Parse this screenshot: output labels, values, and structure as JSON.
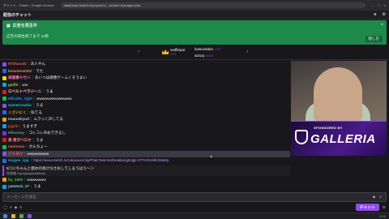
{
  "browser": {
    "title": "チャット - Twitch - Google Chrome",
    "url": "dashboard.twitch.tv/popout/u/.../stream-manager/chat",
    "controls": [
      "–",
      "□",
      "×"
    ]
  },
  "header": {
    "title": "配信のチャット",
    "icons": [
      "users-icon",
      "gear-icon"
    ]
  },
  "ad": {
    "title": "広告を再生中",
    "subtitle": "広告の再生終了まで 14秒",
    "button": "隠しを"
  },
  "leaderboard": {
    "first": {
      "name": "wafflepar",
      "bits": "173"
    },
    "second": {
      "name": "katsuokako",
      "bits": "172"
    },
    "third": {
      "name": "aizuoj",
      "bits": "6975"
    },
    "count1": "173"
  },
  "messages": [
    {
      "user": "87Shasaki",
      "user_color": "#ff4f4f",
      "badge": "#9147ff",
      "text": "あ人やん"
    },
    {
      "user": "kinanmo0202",
      "user_color": "#ff7f50",
      "badge": "#1f69ff",
      "text": "でた"
    },
    {
      "user": "高額重々せい",
      "user_color": "#ff69b4",
      "badge": "#ffd700",
      "text": "あいつは頭悪ゲームくそうまい"
    },
    {
      "user": "gaifiti",
      "user_color": "#9acd32",
      "badge": "#00a8e8",
      "text": "ww"
    },
    {
      "user": "ロベルトベラジーニ",
      "user_color": "#ffb3ba",
      "badge": "#e91916",
      "text": "うま"
    },
    {
      "user": "ellisabo_right",
      "user_color": "#1e90ff",
      "badge": "#00c853",
      "text": "wwwwwwwwwwwww"
    },
    {
      "user": "numeronakiu",
      "user_color": "#00ced1",
      "badge": "#9147ff",
      "text": "うま"
    },
    {
      "user": "くさいにく",
      "user_color": "#daa520",
      "badge": "#1f69ff",
      "text": "似てる"
    },
    {
      "user": "muouskyurt",
      "user_color": "#b0c4de",
      "badge": "#ff9f00",
      "text": "ムラっく声してる"
    },
    {
      "user": "jagir0",
      "user_color": "#ff4500",
      "badge": "#00a8e8",
      "text": "うますぎ"
    },
    {
      "user": "ellisonoy",
      "user_color": "#5f9ea0",
      "badge": "#8a2be2",
      "text": "コレコレ声おできるし"
    },
    {
      "user": "高 黒沢ベロキ",
      "user_color": "#ff7f7f",
      "badge": "#e91916",
      "text": "うま"
    },
    {
      "user": "nanionsu",
      "user_color": "#ff6347",
      "badge": "#00c853",
      "text": "かんちょー"
    },
    {
      "user": "ひろあけ",
      "user_color": "#ff4f4f",
      "badge": "#9147ff",
      "text": "wwwwwwww",
      "highlight": true
    },
    {
      "user": "mogoe_cpp",
      "user_color": "#00bfff",
      "badge": "#1f69ff",
      "text": "https://www.twitch.tv/rukaxaxx/clip/PlainTalentedSeaBangEdge-9T7sOUMkO6aMy",
      "link": true
    }
  ],
  "reply": {
    "line1": "5◎にちゃんと値めの具けなさおしてしまうはう～ン",
    "line2": "作成者: kyouyuuyouxitexxu"
  },
  "messages2": [
    {
      "user": "liq_2000",
      "user_color": "#32cd32",
      "badge": "#ff9f00",
      "text": "wwwwwww"
    },
    {
      "user": "yamecin_27",
      "user_color": "#87cefa",
      "badge": "#00a8e8",
      "text": "うま"
    }
  ],
  "video": {
    "sponsored_by": "SPONSORED BY",
    "brand": "GALLERIA"
  },
  "input": {
    "placeholder": "メッセージを送信"
  },
  "footer": {
    "points": "0",
    "bits": "0",
    "chat_button": "チャット"
  },
  "taskbar": {
    "time": "0:00"
  }
}
